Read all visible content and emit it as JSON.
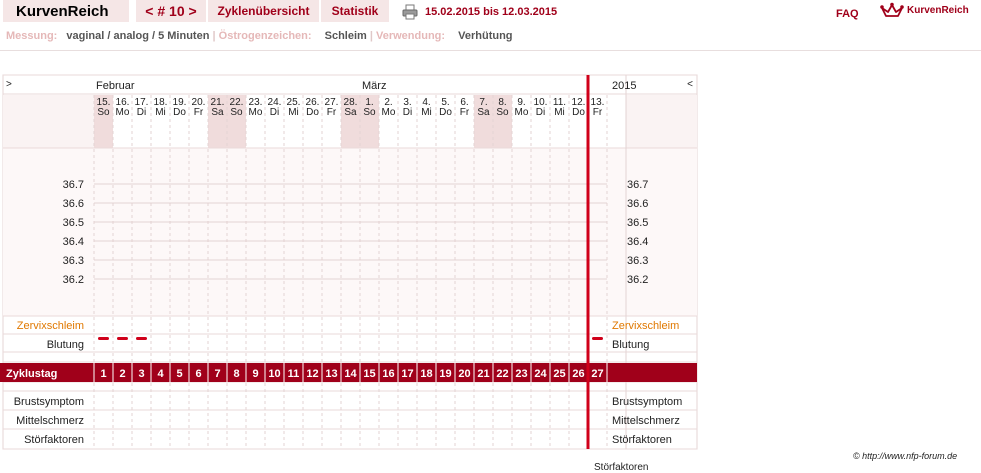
{
  "header": {
    "app_title": "KurvenReich",
    "cycle_nav": "< # 10 >",
    "tab_overview": "Zyklenübersicht",
    "tab_stats": "Statistik",
    "date_range": "15.02.2015 bis 12.03.2015",
    "faq": "FAQ",
    "logo_text": "KurvenReich"
  },
  "info": {
    "measure_label": "Messung:",
    "measure_value": "vaginal / analog / 5 Minuten",
    "estrogen_label": "Östrogenzeichen:",
    "estrogen_value": "Schleim",
    "usage_label": "Verwendung:",
    "usage_value": "Verhütung"
  },
  "chart_data": {
    "type": "line",
    "nav_left": ">",
    "nav_right": "<",
    "year": "2015",
    "months": [
      {
        "name": "Februar",
        "start_index": 0
      },
      {
        "name": "März",
        "start_index": 14
      }
    ],
    "days": [
      {
        "date": "15.",
        "weekday": "So",
        "weekend": true
      },
      {
        "date": "16.",
        "weekday": "Mo",
        "weekend": false
      },
      {
        "date": "17.",
        "weekday": "Di",
        "weekend": false
      },
      {
        "date": "18.",
        "weekday": "Mi",
        "weekend": false
      },
      {
        "date": "19.",
        "weekday": "Do",
        "weekend": false
      },
      {
        "date": "20.",
        "weekday": "Fr",
        "weekend": false
      },
      {
        "date": "21.",
        "weekday": "Sa",
        "weekend": true
      },
      {
        "date": "22.",
        "weekday": "So",
        "weekend": true
      },
      {
        "date": "23.",
        "weekday": "Mo",
        "weekend": false
      },
      {
        "date": "24.",
        "weekday": "Di",
        "weekend": false
      },
      {
        "date": "25.",
        "weekday": "Mi",
        "weekend": false
      },
      {
        "date": "26.",
        "weekday": "Do",
        "weekend": false
      },
      {
        "date": "27.",
        "weekday": "Fr",
        "weekend": false
      },
      {
        "date": "28.",
        "weekday": "Sa",
        "weekend": true
      },
      {
        "date": "1.",
        "weekday": "So",
        "weekend": true
      },
      {
        "date": "2.",
        "weekday": "Mo",
        "weekend": false
      },
      {
        "date": "3.",
        "weekday": "Di",
        "weekend": false
      },
      {
        "date": "4.",
        "weekday": "Mi",
        "weekend": false
      },
      {
        "date": "5.",
        "weekday": "Do",
        "weekend": false
      },
      {
        "date": "6.",
        "weekday": "Fr",
        "weekend": false
      },
      {
        "date": "7.",
        "weekday": "Sa",
        "weekend": true
      },
      {
        "date": "8.",
        "weekday": "So",
        "weekend": true
      },
      {
        "date": "9.",
        "weekday": "Mo",
        "weekend": false
      },
      {
        "date": "10.",
        "weekday": "Di",
        "weekend": false
      },
      {
        "date": "11.",
        "weekday": "Mi",
        "weekend": false
      },
      {
        "date": "12.",
        "weekday": "Do",
        "weekend": false
      },
      {
        "date": "13.",
        "weekday": "Fr",
        "weekend": false
      }
    ],
    "y_ticks": [
      "36.7",
      "36.6",
      "36.5",
      "36.4",
      "36.3",
      "36.2"
    ],
    "temperatures": [],
    "cervical_mucus_label": "Zervixschleim",
    "bleeding_label": "Blutung",
    "bleeding_cycle_days": [
      1,
      2,
      3,
      27
    ],
    "cycle_day_label": "Zyklustag",
    "cycle_days": [
      "1",
      "2",
      "3",
      "4",
      "5",
      "6",
      "7",
      "8",
      "9",
      "10",
      "11",
      "12",
      "13",
      "14",
      "15",
      "16",
      "17",
      "18",
      "19",
      "20",
      "21",
      "22",
      "23",
      "24",
      "25",
      "26",
      "27"
    ],
    "symptom_rows": [
      "Brustsymptom",
      "Mittelschmerz",
      "Störfaktoren"
    ],
    "colors": {
      "accent": "#a0001a",
      "weekend": "#f0dcdc",
      "panel": "#faf3f3",
      "mucus_label": "#e07800"
    }
  },
  "footer": {
    "copyright": "© http://www.nfp-forum.de",
    "cutoff_text": "Störfaktoren"
  }
}
